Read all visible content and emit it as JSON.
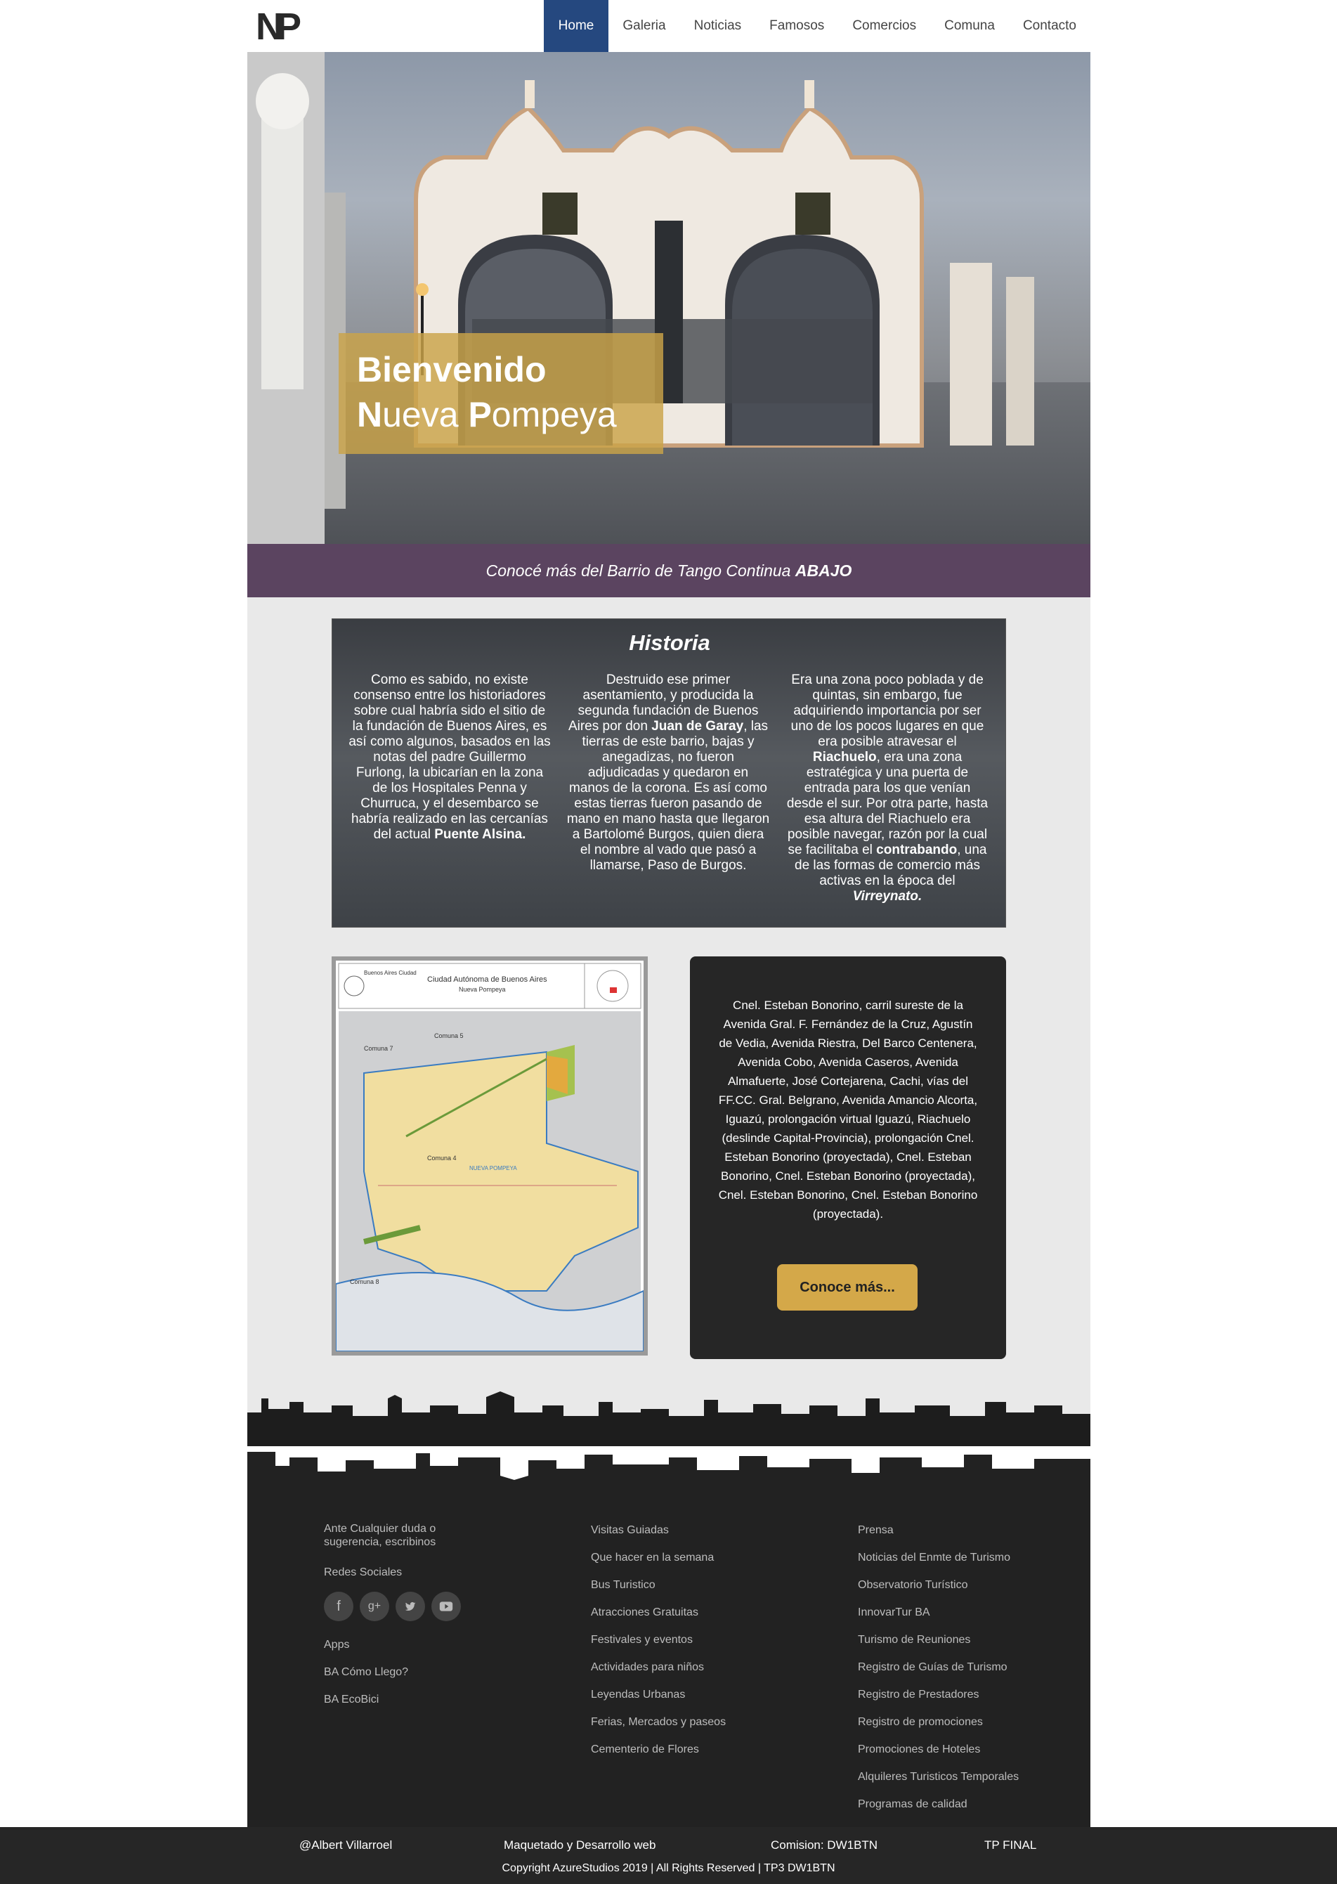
{
  "brand": {
    "logo_text": "NP"
  },
  "nav": [
    {
      "label": "Home",
      "active": true
    },
    {
      "label": "Galeria",
      "active": false
    },
    {
      "label": "Noticias",
      "active": false
    },
    {
      "label": "Famosos",
      "active": false
    },
    {
      "label": "Comercios",
      "active": false
    },
    {
      "label": "Comuna",
      "active": false
    },
    {
      "label": "Contacto",
      "active": false
    }
  ],
  "hero": {
    "title": "Bienvenido",
    "subtitle_cap1": "N",
    "subtitle_rest1": "ueva ",
    "subtitle_cap2": "P",
    "subtitle_rest2": "ompeya"
  },
  "banner": {
    "text": "Conocé más del Barrio de Tango Continua ",
    "emph": "ABAJO"
  },
  "historia": {
    "title": "Historia",
    "col1_a": "Como es sabido, no existe consenso entre los historiadores sobre cual habría sido el sitio de la fundación de Buenos Aires, es así como algunos, basados en las notas del padre Guillermo Furlong, la ubicarían en la zona de los Hospitales Penna y Churruca, y el desembarco se habría realizado en las cercanías del actual ",
    "col1_b": "Puente Alsina.",
    "col2_a": "Destruido ese primer asentamiento, y producida la segunda fundación de Buenos Aires por don ",
    "col2_b": "Juan de Garay",
    "col2_c": ", las tierras de este barrio, bajas y anegadizas, no fueron adjudicadas y quedaron en manos de la corona. Es así como estas tierras fueron pasando de mano en mano hasta que llegaron a Bartolomé Burgos, quien diera el nombre al vado que pasó a llamarse, Paso de Burgos.",
    "col3_a": "Era una zona poco poblada y de quintas, sin embargo, fue adquiriendo importancia por ser uno de los pocos lugares en que era posible atravesar el ",
    "col3_b": "Riachuelo",
    "col3_c": ", era una zona estratégica y una puerta de entrada para los que venían desde el sur. Por otra parte, hasta esa altura del Riachuelo era posible navegar, razón por la cual se facilitaba el ",
    "col3_d": "contrabando",
    "col3_e": ", una de las formas de comercio más activas en la época del ",
    "col3_f": "Virreynato."
  },
  "map": {
    "header_left": "Buenos Aires Ciudad",
    "title": "Ciudad Autónoma de Buenos Aires",
    "subtitle": "Nueva Pompeya",
    "labels": [
      "Comuna 4",
      "NUEVA POMPEYA",
      "Comuna 7",
      "Comuna 8",
      "Comuna 5"
    ]
  },
  "info": {
    "text": "Cnel. Esteban Bonorino, carril sureste de la Avenida Gral. F. Fernández de la Cruz, Agustín de Vedia, Avenida Riestra, Del Barco Centenera, Avenida Cobo, Avenida Caseros, Avenida Almafuerte, José Cortejarena, Cachi, vías del FF.CC. Gral. Belgrano, Avenida Amancio Alcorta, Iguazú, prolongación virtual Iguazú, Riachuelo (deslinde Capital-Provincia), prolongación Cnel. Esteban Bonorino (proyectada), Cnel. Esteban Bonorino, Cnel. Esteban Bonorino (proyectada), Cnel. Esteban Bonorino, Cnel. Esteban Bonorino (proyectada).",
    "button": "Conoce más..."
  },
  "footer": {
    "col1": {
      "note": "Ante Cualquier duda o sugerencia, escribinos",
      "redes": "Redes Sociales",
      "socials": [
        "facebook-icon",
        "google-plus-icon",
        "twitter-icon",
        "youtube-icon"
      ],
      "items": [
        "Apps",
        "BA Cómo Llego?",
        "BA EcoBici"
      ]
    },
    "col2": [
      "Visitas Guiadas",
      "Que hacer en la semana",
      "Bus Turistico",
      "Atracciones Gratuitas",
      "Festivales y eventos",
      "Actividades para niños",
      "Leyendas Urbanas",
      "Ferias, Mercados y paseos",
      "Cementerio de Flores"
    ],
    "col3": [
      "Prensa",
      "Noticias del Enmte de Turismo",
      "Observatorio Turístico",
      "InnovarTur BA",
      "Turismo de Reuniones",
      "Registro de Guías de Turismo",
      "Registro de Prestadores",
      "Registro de promociones",
      "Promociones de Hoteles",
      "Alquileres Turisticos Temporales",
      "Programas de calidad"
    ]
  },
  "bottom": {
    "author": "@Albert Villarroel",
    "made": "Maquetado y Desarrollo web",
    "comision": "Comision: DW1BTN",
    "tp": "TP FINAL",
    "copyright": "Copyright AzureStudios 2019 | All Rights Reserved | TP3 DW1BTN"
  }
}
